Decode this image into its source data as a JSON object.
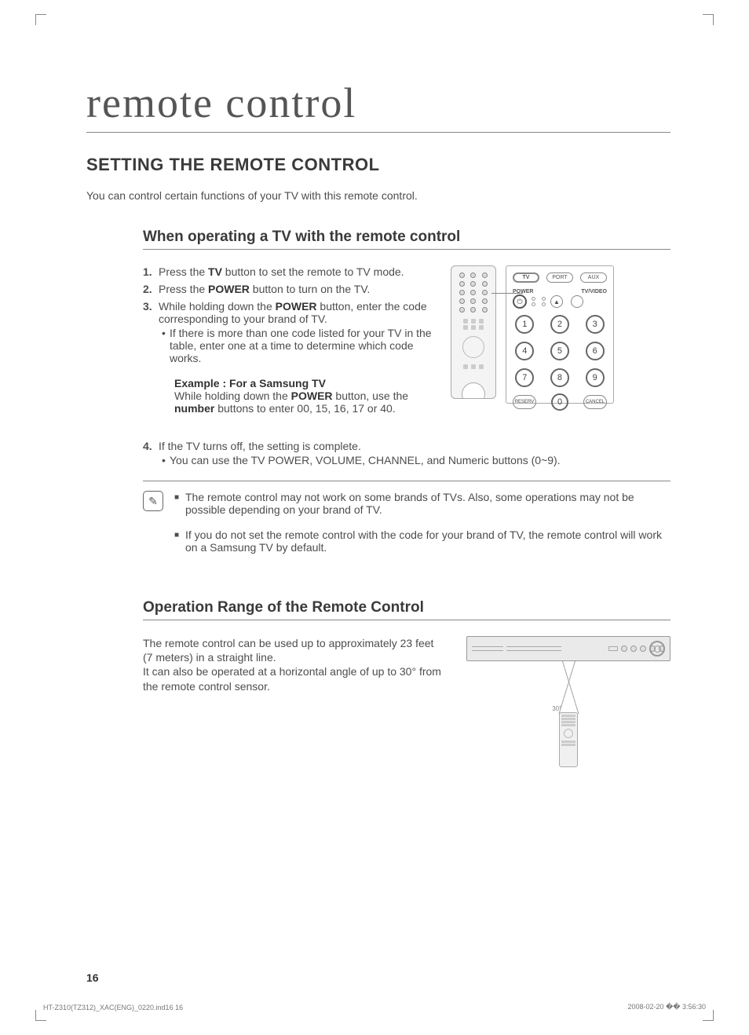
{
  "chapter": "remote control",
  "section": "SETTING THE REMOTE CONTROL",
  "intro": "You can control certain functions of your TV with this remote control.",
  "sub1": "When operating a TV with the remote control",
  "steps": [
    {
      "n": "1.",
      "prefix": "Press the ",
      "bold": "TV",
      "suffix": " button to set the remote to TV mode."
    },
    {
      "n": "2.",
      "prefix": "Press the ",
      "bold": "POWER",
      "suffix": " button to turn on the TV."
    },
    {
      "n": "3.",
      "prefix": "While holding down the ",
      "bold": "POWER",
      "suffix": " button, enter the code corresponding to your brand of TV."
    }
  ],
  "step3_bullet": "If there is more than one code listed for your TV in the table, enter one at a time to determine which code works.",
  "example_label": "Example : For a Samsung TV",
  "example_prefix": "While holding down the ",
  "example_b1": "POWER",
  "example_mid": " button, use the ",
  "example_b2": "number",
  "example_suffix": " buttons to enter 00, 15, 16, 17 or 40.",
  "step4_n": "4.",
  "step4_text": "If the TV turns off, the setting is complete.",
  "step4_bullet": "You can use the TV POWER, VOLUME, CHANNEL, and Numeric buttons (0~9).",
  "notes": [
    "The remote control may not work on some brands of TVs. Also, some operations may not be possible depending on your brand of TV.",
    "If you do not set the remote control with the code for your brand of TV, the remote control will work on a Samsung TV by default."
  ],
  "sub2": "Operation Range of the Remote Control",
  "range_text1": "The remote control can be used up to approximately 23 feet (7 meters) in a straight line.",
  "range_text2": "It can also be operated at a horizontal angle of up to 30° from the remote control sensor.",
  "keypad": {
    "mode_buttons": [
      "TV",
      "PORT",
      "AUX"
    ],
    "label_power": "POWER",
    "label_tvvideo": "TV/VIDEO",
    "numbers": [
      "1",
      "2",
      "3",
      "4",
      "5",
      "6",
      "7",
      "8",
      "9"
    ],
    "bottom_left": "RESERV",
    "bottom_mid": "0",
    "bottom_right": "CANCEL"
  },
  "angle_label": "30°",
  "page_number": "16",
  "footer_left": "HT-Z310(TZ312)_XAC(ENG)_0220.ind16   16",
  "footer_right": "2008-02-20   �� 3:56:30"
}
